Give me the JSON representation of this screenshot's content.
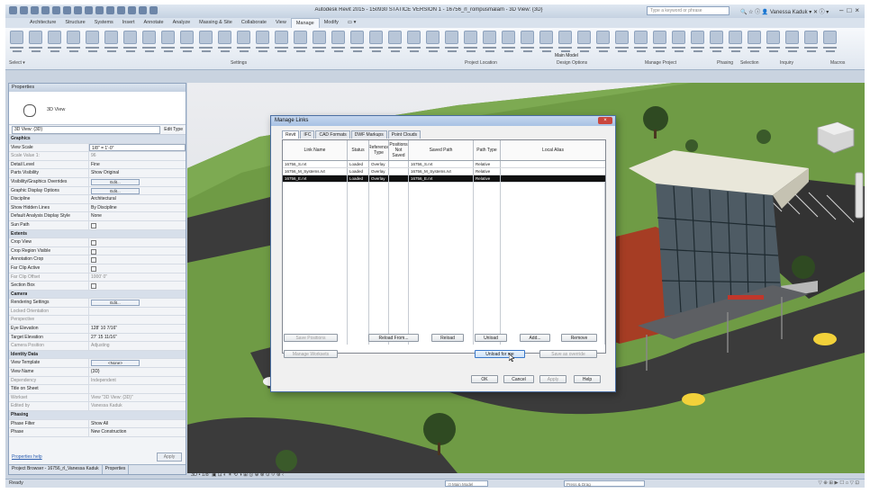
{
  "window": {
    "title": "Autodesk Revit 2015 - 150930 STATICE VERSION 1 - 16756_rl_rompusmalam - 3D View: {3D}",
    "search_placeholder": "Type a keyword or phrase",
    "user": "Vanessa Kaduk",
    "controls": [
      "–",
      "□",
      "×"
    ]
  },
  "ribbon": {
    "tabs": [
      "Architecture",
      "Structure",
      "Systems",
      "Insert",
      "Annotate",
      "Analyze",
      "Massing & Site",
      "Collaborate",
      "View",
      "Manage",
      "Modify",
      "▭ ▾"
    ],
    "active_tab": "Manage",
    "select_label": "Select ▾",
    "panels": [
      "Settings",
      "Project Location",
      "Design Options",
      "Manage Project",
      "Phasing",
      "Selection",
      "Inquiry",
      "Macros"
    ],
    "design_option_value": "Main Model"
  },
  "properties": {
    "header": "Properties",
    "type_name": "3D View",
    "filter": "3D View: {3D}",
    "edit_type": "Edit Type",
    "rows": [
      {
        "k": "Graphics",
        "v": "",
        "cat": true
      },
      {
        "k": "View Scale",
        "v": "1/8\" = 1'-0\"",
        "field": true
      },
      {
        "k": "Scale Value    1:",
        "v": "96",
        "dim": true
      },
      {
        "k": "Detail Level",
        "v": "Fine"
      },
      {
        "k": "Parts Visibility",
        "v": "Show Original"
      },
      {
        "k": "Visibility/Graphics Overrides",
        "v": "Edit...",
        "btn": true
      },
      {
        "k": "Graphic Display Options",
        "v": "Edit...",
        "btn": true
      },
      {
        "k": "Discipline",
        "v": "Architectural"
      },
      {
        "k": "Show Hidden Lines",
        "v": "By Discipline"
      },
      {
        "k": "Default Analysis Display Style",
        "v": "None"
      },
      {
        "k": "Sun Path",
        "v": "",
        "chk": true
      },
      {
        "k": "Extents",
        "v": "",
        "cat": true
      },
      {
        "k": "Crop View",
        "v": "",
        "chk": true
      },
      {
        "k": "Crop Region Visible",
        "v": "",
        "chk": true
      },
      {
        "k": "Annotation Crop",
        "v": "",
        "chk": true
      },
      {
        "k": "Far Clip Active",
        "v": "",
        "chk": true
      },
      {
        "k": "Far Clip Offset",
        "v": "1000' 0\"",
        "dim": true
      },
      {
        "k": "Section Box",
        "v": "",
        "chk": true
      },
      {
        "k": "Camera",
        "v": "",
        "cat": true
      },
      {
        "k": "Rendering Settings",
        "v": "Edit...",
        "btn": true
      },
      {
        "k": "Locked Orientation",
        "v": "",
        "dim": true
      },
      {
        "k": "Perspective",
        "v": "",
        "dim": true
      },
      {
        "k": "Eye Elevation",
        "v": "128' 10 7/16\""
      },
      {
        "k": "Target Elevation",
        "v": "27' 15 11/16\""
      },
      {
        "k": "Camera Position",
        "v": "Adjusting",
        "dim": true
      },
      {
        "k": "Identity Data",
        "v": "",
        "cat": true
      },
      {
        "k": "View Template",
        "v": "<None>",
        "btn": true
      },
      {
        "k": "View Name",
        "v": "{3D}"
      },
      {
        "k": "Dependency",
        "v": "Independent",
        "dim": true
      },
      {
        "k": "Title on Sheet",
        "v": ""
      },
      {
        "k": "Workset",
        "v": "View \"3D View: {3D}\"",
        "dim": true
      },
      {
        "k": "Edited by",
        "v": "Vanessa Kaduk",
        "dim": true
      },
      {
        "k": "Phasing",
        "v": "",
        "cat": true
      },
      {
        "k": "Phase Filter",
        "v": "Show All"
      },
      {
        "k": "Phase",
        "v": "New Construction"
      }
    ],
    "help_link": "Properties help",
    "apply": "Apply",
    "bottom_tabs": [
      "Project Browser - 16756_rl_Vanessa Kaduk",
      "Properties"
    ]
  },
  "dialog": {
    "title": "Manage Links",
    "close": "×",
    "tabs": [
      "Revit",
      "IFC",
      "CAD Formats",
      "DWF Markups",
      "Point Clouds"
    ],
    "active_tab": "Revit",
    "columns": [
      "Link Name",
      "Status",
      "Reference Type",
      "Positions Not Saved",
      "Saved Path",
      "Path Type",
      "Local Alias"
    ],
    "rows": [
      {
        "name": "16756_S.rvt",
        "status": "Loaded",
        "ref": "Overlay",
        "saved": "",
        "path": "16756_S.rvt",
        "ptype": "Relative",
        "alias": "",
        "selected": false
      },
      {
        "name": "16756_M_Systems.rvt",
        "status": "Loaded",
        "ref": "Overlay",
        "saved": "",
        "path": "16756_M_Systems.rvt",
        "ptype": "Relative",
        "alias": "",
        "selected": false
      },
      {
        "name": "16756_E.rvt",
        "status": "Loaded",
        "ref": "Overlay",
        "saved": "",
        "path": "16756_E.rvt",
        "ptype": "Relative",
        "alias": "",
        "selected": true
      }
    ],
    "buttons": {
      "save_positions": "Save Positions",
      "reload_from": "Reload From...",
      "reload": "Reload",
      "unload": "Unload",
      "add": "Add...",
      "remove": "Remove",
      "manage_worksets": "Manage Worksets",
      "unload_for_me": "Unload for me",
      "save_as_override": "Save as override",
      "ok": "OK",
      "cancel": "Cancel",
      "apply": "Apply",
      "help": "Help"
    }
  },
  "view_controls": "3D • 1/8\" ▣ ⊡ ◐ ☀ ⟲ ◑ ⊞ ◎ ⊕ ⊗ ⊙ ⟐ ⊛ ‹",
  "status": {
    "left": "Ready",
    "main_model": ":0  Main Model",
    "editable": "Press & Drag",
    "right_icons": "▽ ⊕ ⊞ ▶ ☐ ⌂ ▽ ⊡"
  },
  "colors": {
    "ribbon_bg": "#dfe6ef",
    "dialog_border": "#4b6fa3",
    "selected_row": "#111111",
    "grass": "#6f9b45",
    "road": "#3b3b3b",
    "brick": "#a63d24"
  }
}
